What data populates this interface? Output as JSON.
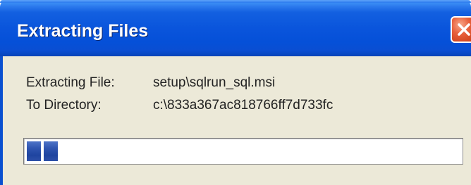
{
  "window": {
    "title": "Extracting Files"
  },
  "labels": {
    "extracting_file_label": "Extracting File:",
    "extracting_file_value": "setup\\sqlrun_sql.msi",
    "to_directory_label": "To Directory:",
    "to_directory_value": "c:\\833a367ac818766ff7d733fc"
  },
  "progress": {
    "value_percent": 6,
    "color": "#2f55b0"
  },
  "icons": {
    "close": "close-icon"
  },
  "colors": {
    "titlebar": "#0a55dc",
    "dialog_background": "#ece9d8",
    "close_button": "#d2451f"
  }
}
